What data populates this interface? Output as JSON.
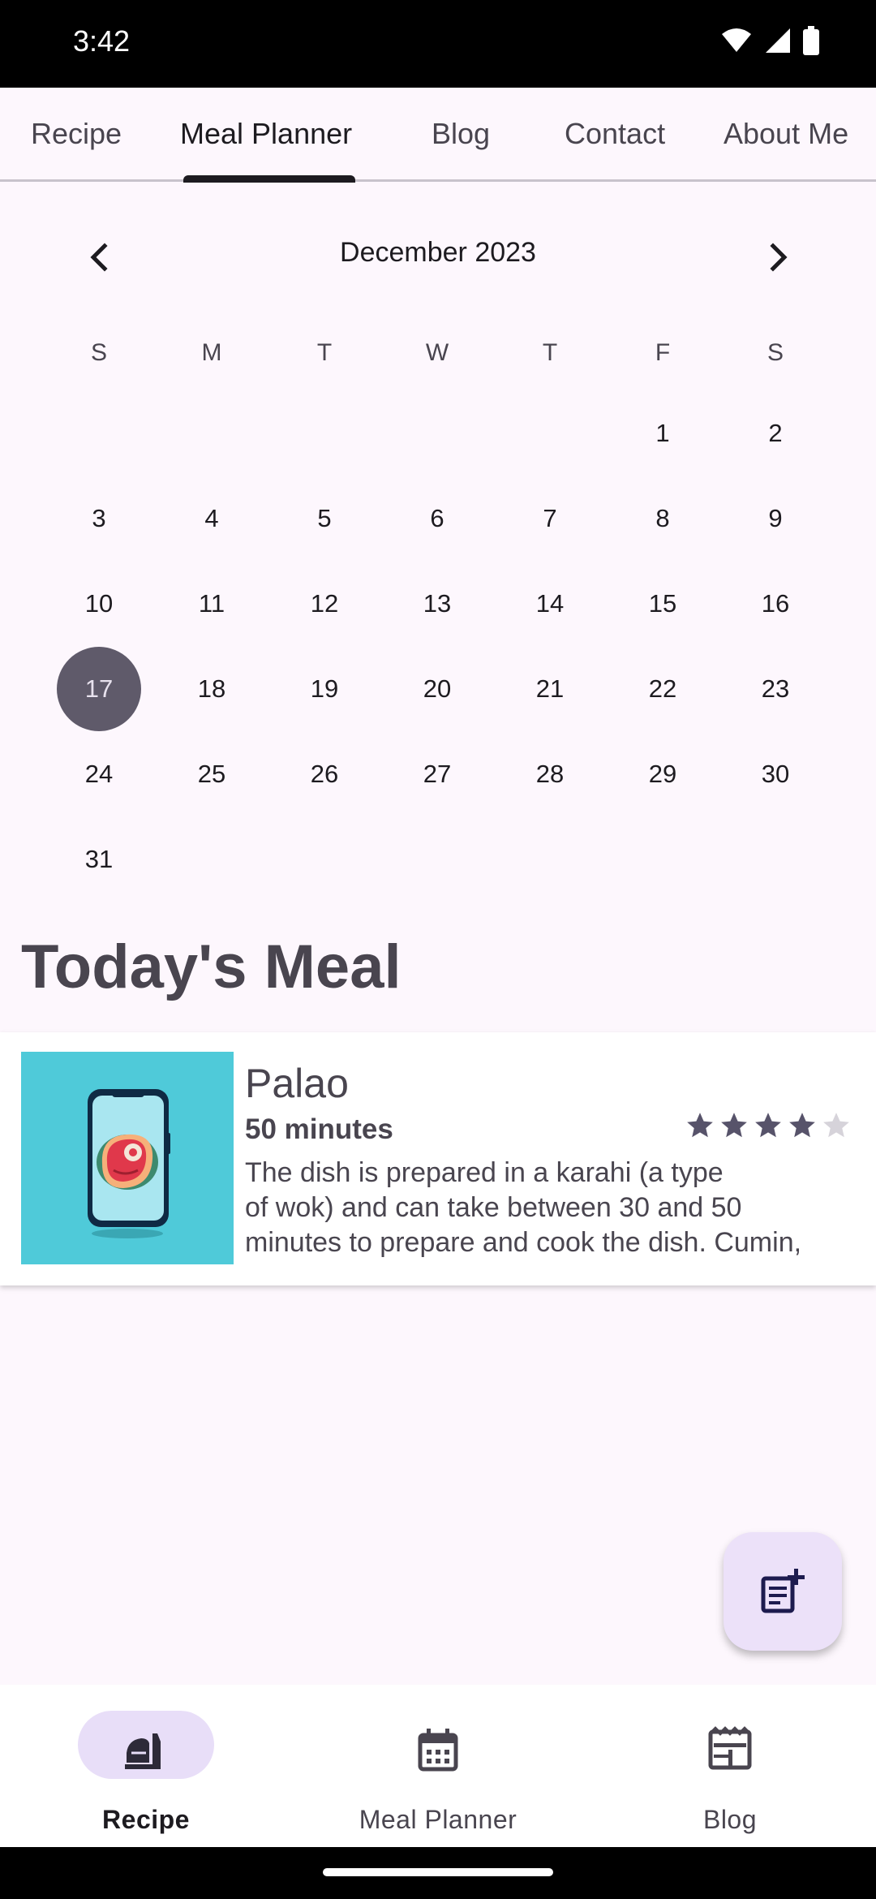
{
  "status_bar": {
    "time": "3:42"
  },
  "top_tabs": [
    {
      "label": "Recipe",
      "active": false
    },
    {
      "label": "Meal Planner",
      "active": true
    },
    {
      "label": "Blog",
      "active": false
    },
    {
      "label": "Contact",
      "active": false
    },
    {
      "label": "About Me",
      "active": false
    }
  ],
  "calendar": {
    "title": "December 2023",
    "weekdays": [
      "S",
      "M",
      "T",
      "W",
      "T",
      "F",
      "S"
    ],
    "first_weekday_index": 5,
    "days_in_month": 31,
    "selected_day": 17
  },
  "section_title": "Today's Meal",
  "meal": {
    "name": "Palao",
    "time": "50 minutes",
    "rating": 4,
    "rating_max": 5,
    "description_lines": [
      "The dish is prepared in a karahi (a type",
      "of wok) and can take between 30 and 50",
      "minutes to prepare and cook the dish. Cumin,"
    ]
  },
  "bottom_nav": [
    {
      "label": "Recipe",
      "icon": "recipe-icon",
      "active": true
    },
    {
      "label": "Meal Planner",
      "icon": "calendar-icon",
      "active": false
    },
    {
      "label": "Blog",
      "icon": "blog-icon",
      "active": false
    }
  ],
  "colors": {
    "background": "#fdf7fd",
    "selected_day": "#5f5a6a",
    "nav_pill": "#e8def8",
    "fab": "#ece1f9",
    "star_filled": "#57536a",
    "star_empty": "#d6d3da"
  }
}
